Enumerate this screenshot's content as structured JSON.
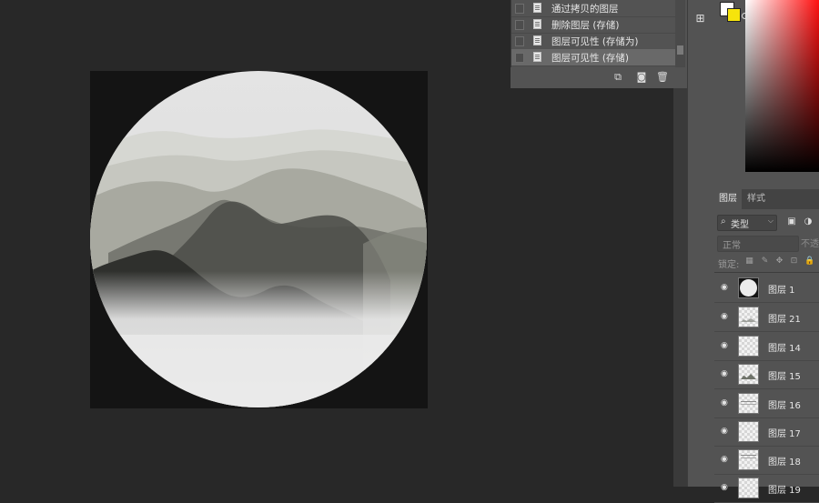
{
  "history": {
    "items": [
      {
        "label": "通过拷贝的图层",
        "selected": false
      },
      {
        "label": "删除图层 (存储)",
        "selected": false
      },
      {
        "label": "图层可见性 (存储为)",
        "selected": false
      },
      {
        "label": "图层可见性 (存储)",
        "selected": true
      }
    ],
    "footer_icons": [
      "new-snapshot-icon",
      "camera-icon",
      "trash-icon"
    ]
  },
  "color": {
    "foreground": "#ffffff",
    "background": "#f6e40c",
    "picker_hue": "#ff1010"
  },
  "layers_panel": {
    "tabs": [
      {
        "label": "图层",
        "active": true
      },
      {
        "label": "样式",
        "active": false
      }
    ],
    "filter_label": "类型",
    "blend_mode": "正常",
    "opacity_label": "不透",
    "lock_label": "锁定:",
    "layers": [
      {
        "name": "图层 1",
        "thumb": "circle",
        "visible": true
      },
      {
        "name": "图层 21",
        "thumb": "lines",
        "visible": true
      },
      {
        "name": "图层 14",
        "thumb": "empty",
        "visible": true
      },
      {
        "name": "图层 15",
        "thumb": "mountain",
        "visible": true
      },
      {
        "name": "图层 16",
        "thumb": "lines",
        "visible": true
      },
      {
        "name": "图层 17",
        "thumb": "empty",
        "visible": true
      },
      {
        "name": "图层 18",
        "thumb": "lines",
        "visible": true
      },
      {
        "name": "图层 19",
        "thumb": "empty",
        "visible": true
      }
    ]
  },
  "canvas": {
    "background": "#141414",
    "artwork": "ink-wash mountains in circle"
  }
}
